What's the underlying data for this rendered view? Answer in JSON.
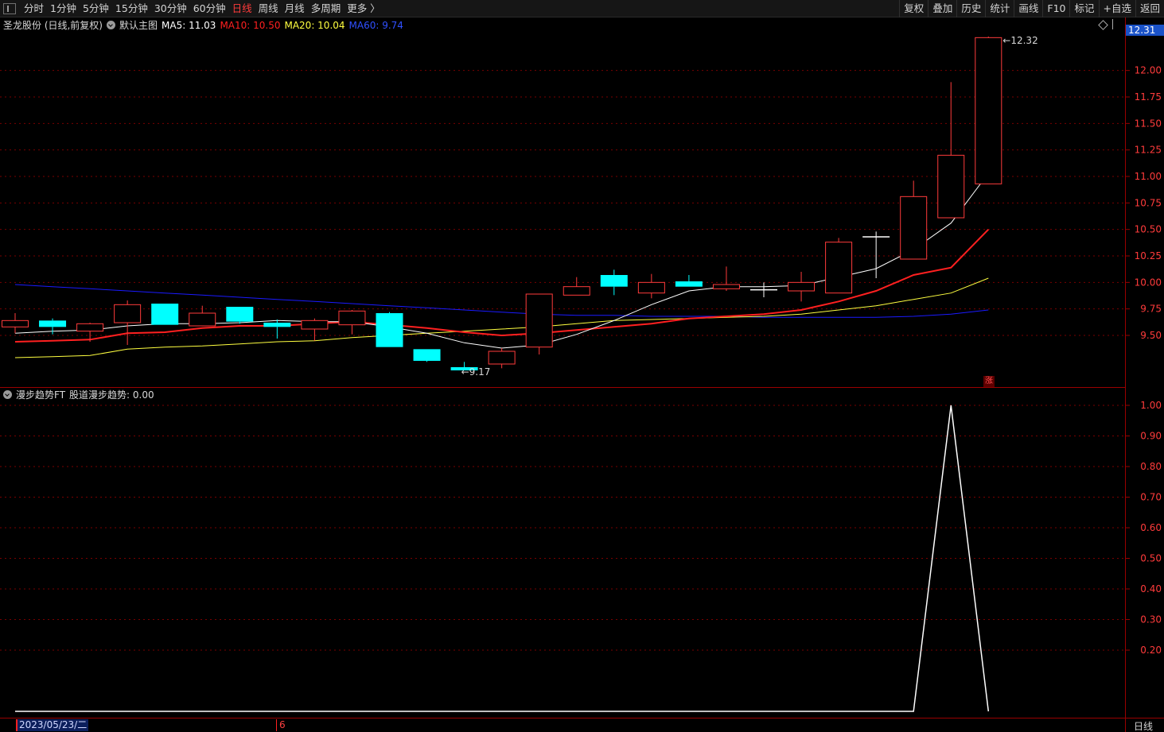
{
  "toolbar": {
    "tabs": [
      {
        "label": "分时",
        "active": false
      },
      {
        "label": "1分钟",
        "active": false
      },
      {
        "label": "5分钟",
        "active": false
      },
      {
        "label": "15分钟",
        "active": false
      },
      {
        "label": "30分钟",
        "active": false
      },
      {
        "label": "60分钟",
        "active": false
      },
      {
        "label": "日线",
        "active": true
      },
      {
        "label": "周线",
        "active": false
      },
      {
        "label": "月线",
        "active": false
      },
      {
        "label": "多周期",
        "active": false
      },
      {
        "label": "更多 〉",
        "active": false
      }
    ],
    "right_buttons": [
      "复权",
      "叠加",
      "历史",
      "统计",
      "画线",
      "F10",
      "标记",
      "+自选",
      "返回"
    ]
  },
  "main_legend": {
    "title": "圣龙股份 (日线,前复权)",
    "template": "默认主图",
    "ma5": "MA5: 11.03",
    "ma10": "MA10: 10.50",
    "ma20": "MA20: 10.04",
    "ma60": "MA60: 9.74"
  },
  "sub_legend": {
    "title": "漫步趋势FT",
    "value": "股道漫步趋势: 0.00"
  },
  "current_price_label": "12.31",
  "high_marker": "12.32",
  "low_marker": "9.17",
  "zhang_badge": "涨",
  "period_label": "日线",
  "date_bar": {
    "cursor_date": "2023/05/23/二",
    "month_tick": "6"
  },
  "colors": {
    "up": "#ff3b3b",
    "down": "#00ffff",
    "ma5": "#ffffff",
    "ma10": "#ff2020",
    "ma20": "#ffff40",
    "ma60": "#1a1aff",
    "grid": "#7a0000"
  },
  "chart_data": [
    {
      "type": "candlestick",
      "price_axis": {
        "ylim": [
          9.17,
          12.32
        ],
        "tick_labels": [
          "12.00",
          "11.75",
          "11.50",
          "11.25",
          "11.00",
          "10.75",
          "10.50",
          "10.25",
          "10.00",
          "9.75",
          "9.50"
        ],
        "tick_values": [
          12.0,
          11.75,
          11.5,
          11.25,
          11.0,
          10.75,
          10.5,
          10.25,
          10.0,
          9.75,
          9.5
        ]
      },
      "candles": [
        {
          "o": 9.58,
          "c": 9.64,
          "h": 9.71,
          "l": 9.52
        },
        {
          "o": 9.64,
          "c": 9.58,
          "h": 9.66,
          "l": 9.51
        },
        {
          "o": 9.54,
          "c": 9.61,
          "h": 9.62,
          "l": 9.44
        },
        {
          "o": 9.62,
          "c": 9.79,
          "h": 9.83,
          "l": 9.41
        },
        {
          "o": 9.8,
          "c": 9.6,
          "h": 9.8,
          "l": 9.6
        },
        {
          "o": 9.59,
          "c": 9.71,
          "h": 9.78,
          "l": 9.59
        },
        {
          "o": 9.77,
          "c": 9.63,
          "h": 9.77,
          "l": 9.61
        },
        {
          "o": 9.62,
          "c": 9.58,
          "h": 9.65,
          "l": 9.47
        },
        {
          "o": 9.56,
          "c": 9.64,
          "h": 9.66,
          "l": 9.45
        },
        {
          "o": 9.6,
          "c": 9.73,
          "h": 9.74,
          "l": 9.51
        },
        {
          "o": 9.71,
          "c": 9.39,
          "h": 9.72,
          "l": 9.39
        },
        {
          "o": 9.37,
          "c": 9.26,
          "h": 9.37,
          "l": 9.25
        },
        {
          "o": 9.2,
          "c": 9.17,
          "h": 9.25,
          "l": 9.17
        },
        {
          "o": 9.23,
          "c": 9.35,
          "h": 9.38,
          "l": 9.19
        },
        {
          "o": 9.39,
          "c": 9.89,
          "h": 9.89,
          "l": 9.32
        },
        {
          "o": 9.88,
          "c": 9.96,
          "h": 10.05,
          "l": 9.88
        },
        {
          "o": 10.07,
          "c": 9.96,
          "h": 10.12,
          "l": 9.88
        },
        {
          "o": 9.9,
          "c": 10.0,
          "h": 10.08,
          "l": 9.85
        },
        {
          "o": 10.01,
          "c": 9.96,
          "h": 10.07,
          "l": 9.96
        },
        {
          "o": 9.94,
          "c": 9.98,
          "h": 10.15,
          "l": 9.92
        },
        {
          "o": 9.93,
          "c": 9.93,
          "h": 10.0,
          "l": 9.86
        },
        {
          "o": 9.92,
          "c": 10.0,
          "h": 10.1,
          "l": 9.82
        },
        {
          "o": 9.9,
          "c": 10.38,
          "h": 10.42,
          "l": 9.9
        },
        {
          "o": 10.43,
          "c": 10.43,
          "h": 10.48,
          "l": 10.04
        },
        {
          "o": 10.22,
          "c": 10.81,
          "h": 10.96,
          "l": 10.22
        },
        {
          "o": 10.61,
          "c": 11.2,
          "h": 11.89,
          "l": 10.61
        },
        {
          "o": 10.93,
          "c": 12.31,
          "h": 12.32,
          "l": 10.93
        }
      ],
      "ma5": [
        9.52,
        9.54,
        9.55,
        9.59,
        9.61,
        9.61,
        9.62,
        9.64,
        9.63,
        9.63,
        9.58,
        9.52,
        9.43,
        9.38,
        9.41,
        9.51,
        9.64,
        9.79,
        9.92,
        9.96,
        9.96,
        9.97,
        10.05,
        10.13,
        10.31,
        10.56,
        11.03
      ],
      "ma10": [
        9.44,
        9.45,
        9.46,
        9.52,
        9.53,
        9.57,
        9.59,
        9.59,
        9.61,
        9.63,
        9.6,
        9.57,
        9.53,
        9.5,
        9.52,
        9.55,
        9.58,
        9.61,
        9.66,
        9.68,
        9.7,
        9.74,
        9.82,
        9.92,
        10.07,
        10.14,
        10.5
      ],
      "ma20": [
        9.29,
        9.3,
        9.31,
        9.37,
        9.39,
        9.4,
        9.42,
        9.44,
        9.45,
        9.48,
        9.5,
        9.52,
        9.54,
        9.56,
        9.58,
        9.61,
        9.64,
        9.65,
        9.66,
        9.67,
        9.68,
        9.7,
        9.74,
        9.78,
        9.84,
        9.9,
        10.04
      ],
      "ma60": [
        9.98,
        9.96,
        9.94,
        9.92,
        9.9,
        9.88,
        9.86,
        9.84,
        9.82,
        9.8,
        9.78,
        9.76,
        9.74,
        9.72,
        9.7,
        9.69,
        9.69,
        9.68,
        9.68,
        9.68,
        9.67,
        9.67,
        9.67,
        9.67,
        9.68,
        9.7,
        9.74
      ]
    },
    {
      "type": "line",
      "title": "漫步趋势FT",
      "series": [
        {
          "name": "股道漫步趋势",
          "values": [
            0,
            0,
            0,
            0,
            0,
            0,
            0,
            0,
            0,
            0,
            0,
            0,
            0,
            0,
            0,
            0,
            0,
            0,
            0,
            0,
            0,
            0,
            0,
            0,
            0,
            1,
            0,
            0
          ]
        }
      ],
      "ylim": [
        0,
        1.0
      ],
      "tick_labels": [
        "1.00",
        "0.90",
        "0.80",
        "0.70",
        "0.60",
        "0.50",
        "0.40",
        "0.30",
        "0.20"
      ],
      "tick_values": [
        1.0,
        0.9,
        0.8,
        0.7,
        0.6,
        0.5,
        0.4,
        0.3,
        0.2
      ]
    }
  ]
}
